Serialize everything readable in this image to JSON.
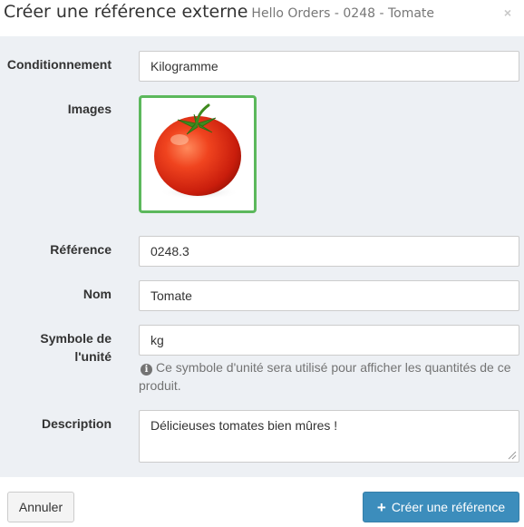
{
  "modal": {
    "title": "Créer une référence externe",
    "subtitle": "Hello Orders - 0248 - Tomate",
    "close_icon": "close-icon",
    "close_label": "×"
  },
  "form": {
    "conditionnement": {
      "label": "Conditionnement",
      "value": "Kilogramme"
    },
    "images": {
      "label": "Images",
      "image": "tomato-photo"
    },
    "reference": {
      "label": "Référence",
      "value": "0248.3"
    },
    "nom": {
      "label": "Nom",
      "value": "Tomate"
    },
    "symbole": {
      "label_line1": "Symbole de",
      "label_line2": "l'unité",
      "value": "kg",
      "help_icon": "info-icon",
      "help_text": "Ce symbole d'unité sera utilisé pour afficher les quantités de ce produit."
    },
    "description": {
      "label": "Description",
      "value": "Délicieuses tomates bien mûres !"
    }
  },
  "footer": {
    "cancel_label": "Annuler",
    "create_label": "Créer une référence",
    "create_icon": "plus-icon"
  },
  "colors": {
    "primary": "#3c8dbc",
    "image_border": "#5cb85c",
    "body_bg": "#edf0f4"
  }
}
